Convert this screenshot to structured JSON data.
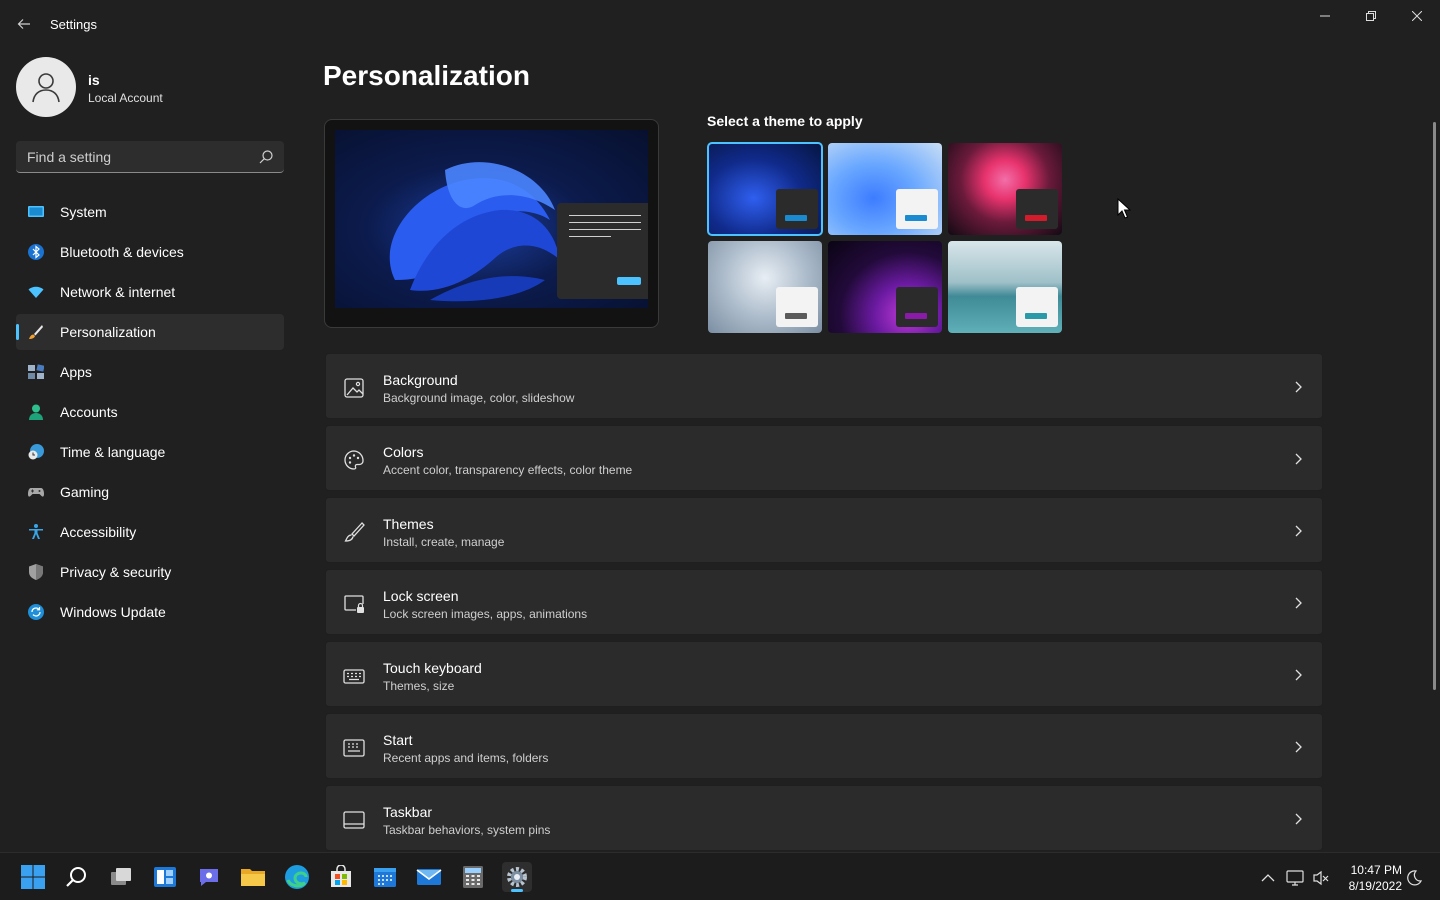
{
  "window": {
    "title": "Settings",
    "back_icon": "arrow-left-icon",
    "controls": [
      "minimize-icon",
      "restore-icon",
      "close-icon"
    ]
  },
  "profile": {
    "name": "is",
    "account_type": "Local Account"
  },
  "search": {
    "placeholder": "Find a setting"
  },
  "sidebar": {
    "items": [
      {
        "label": "System",
        "icon": "system-display-icon",
        "active": false
      },
      {
        "label": "Bluetooth & devices",
        "icon": "bluetooth-icon",
        "active": false
      },
      {
        "label": "Network & internet",
        "icon": "wifi-icon",
        "active": false
      },
      {
        "label": "Personalization",
        "icon": "paintbrush-icon",
        "active": true
      },
      {
        "label": "Apps",
        "icon": "apps-icon",
        "active": false
      },
      {
        "label": "Accounts",
        "icon": "person-icon",
        "active": false
      },
      {
        "label": "Time & language",
        "icon": "globe-clock-icon",
        "active": false
      },
      {
        "label": "Gaming",
        "icon": "gamepad-icon",
        "active": false
      },
      {
        "label": "Accessibility",
        "icon": "accessibility-icon",
        "active": false
      },
      {
        "label": "Privacy & security",
        "icon": "shield-icon",
        "active": false
      },
      {
        "label": "Windows Update",
        "icon": "sync-icon",
        "active": false
      }
    ]
  },
  "main": {
    "title": "Personalization",
    "theme_heading": "Select a theme to apply",
    "themes": [
      {
        "name": "windows-dark-theme",
        "selected": true
      },
      {
        "name": "windows-light-theme",
        "selected": false
      },
      {
        "name": "glow-theme",
        "selected": false
      },
      {
        "name": "captured-motion-theme",
        "selected": false
      },
      {
        "name": "sunrise-theme",
        "selected": false
      },
      {
        "name": "flow-theme",
        "selected": false
      }
    ],
    "settings": [
      {
        "title": "Background",
        "subtitle": "Background image, color, slideshow",
        "icon": "image-icon"
      },
      {
        "title": "Colors",
        "subtitle": "Accent color, transparency effects, color theme",
        "icon": "palette-icon"
      },
      {
        "title": "Themes",
        "subtitle": "Install, create, manage",
        "icon": "brush-icon"
      },
      {
        "title": "Lock screen",
        "subtitle": "Lock screen images, apps, animations",
        "icon": "lock-screen-icon"
      },
      {
        "title": "Touch keyboard",
        "subtitle": "Themes, size",
        "icon": "keyboard-icon"
      },
      {
        "title": "Start",
        "subtitle": "Recent apps and items, folders",
        "icon": "start-menu-icon"
      },
      {
        "title": "Taskbar",
        "subtitle": "Taskbar behaviors, system pins",
        "icon": "taskbar-icon"
      }
    ]
  },
  "taskbar": {
    "apps": [
      "start-icon",
      "search-icon",
      "task-view-icon",
      "widgets-icon",
      "chat-icon",
      "file-explorer-icon",
      "edge-icon",
      "store-icon",
      "calendar-icon",
      "mail-icon",
      "calculator-icon",
      "settings-icon"
    ],
    "time": "10:47 PM",
    "date": "8/19/2022"
  },
  "colors": {
    "accent": "#4cc2ff",
    "background": "#202020",
    "card": "#2b2b2b"
  }
}
